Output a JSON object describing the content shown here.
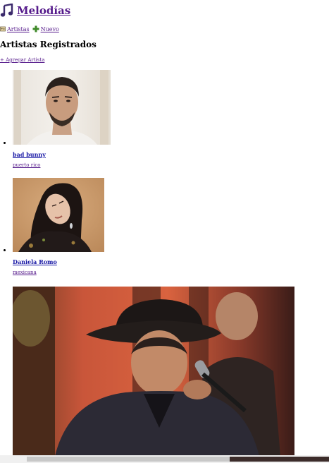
{
  "header": {
    "brand_label": "Melodías",
    "brand_icon": "music-note-icon"
  },
  "nav": {
    "artists_label": "Artistas",
    "artists_icon": "contact-card-icon",
    "new_label": "Nuevo",
    "new_icon": "plus-icon"
  },
  "main": {
    "title": "Artistas Registrados",
    "add_artist_label": "+ Agregar Artista"
  },
  "artists": [
    {
      "name": "bad bunny",
      "origin": "puerto rico"
    },
    {
      "name": "Daniela Romo",
      "origin": "mexicana"
    },
    {
      "name": "",
      "origin": ""
    }
  ],
  "colors": {
    "link": "#551a8b",
    "name_link": "#1a1aa6",
    "accent_icon": "#3b2a6b"
  }
}
